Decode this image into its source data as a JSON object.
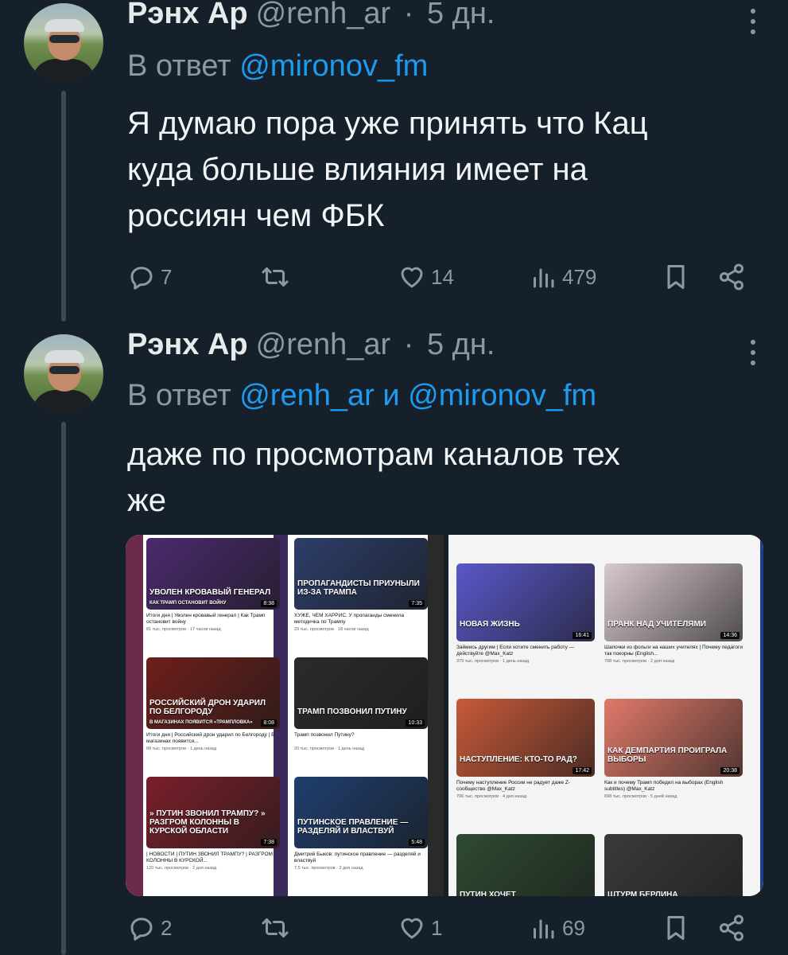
{
  "tweets": [
    {
      "author_name": "Рэнх Ар",
      "handle": "@renh_ar",
      "separator": "·",
      "time": "5 дн.",
      "reply_prefix": "В ответ",
      "reply_mentions": [
        "@mironov_fm"
      ],
      "reply_joiner": "",
      "text_lines": [
        "Я думаю пора уже принять что Кац",
        "куда больше влияния имеет на",
        "россиян чем ФБК"
      ],
      "stats": {
        "replies": "7",
        "retweets": "",
        "likes": "14",
        "views": "479"
      }
    },
    {
      "author_name": "Рэнх Ар",
      "handle": "@renh_ar",
      "separator": "·",
      "time": "5 дн.",
      "reply_prefix": "В ответ",
      "reply_mentions": [
        "@renh_ar",
        "@mironov_fm"
      ],
      "reply_joiner": "и",
      "text_lines": [
        "даже по просмотрам каналов тех",
        "же"
      ],
      "stats": {
        "replies": "2",
        "retweets": "",
        "likes": "1",
        "views": "69"
      }
    }
  ],
  "icons": {
    "more": "more-vertical-icon",
    "reply": "reply-icon",
    "retweet": "retweet-icon",
    "like": "heart-icon",
    "views": "views-icon",
    "bookmark": "bookmark-icon",
    "share": "share-icon"
  },
  "media": {
    "left_videos": [
      {
        "caption": "Уволен кровавый генерал",
        "sub": "Как Трамп остановит войну",
        "title": "Итоги дня | Уволен кровавый генерал | Как Трамп остановит войну",
        "meta": "81 тыс. просмотров · 17 часов назад",
        "duration": "8:38",
        "color": "#4a2a6e"
      },
      {
        "caption": "Пропагандисты приуныли из-за Трампа",
        "sub": "",
        "title": "ХУЖЕ, ЧЕМ ХАРРИС. У пропаганды сменила методичка по Трампу",
        "meta": "29 тыс. просмотров · 18 часов назад",
        "duration": "7:35",
        "color": "#2c3e6a"
      },
      {
        "caption": "Российский дрон ударил по Белгороду",
        "sub": "В магазинах появится «Трампловка»",
        "title": "Итоги дня | Российский дрон ударил по Белгороду | В магазинах появится...",
        "meta": "68 тыс. просмотров · 1 день назад",
        "duration": "8:08",
        "color": "#6e1f1a"
      },
      {
        "caption": "Трамп позвонил Путину",
        "sub": "",
        "title": "Трамп позвонил Путину?",
        "meta": "20 тыс. просмотров · 1 день назад",
        "duration": "10:33",
        "color": "#2b2b2b"
      },
      {
        "caption": "» Путин звонил Трампу? » Разгром колонны в Курской области",
        "sub": "",
        "title": "| НОВОСТИ | ПУТИН ЗВОНИЛ ТРАМПУ? | РАЗГРОМ КОЛОННЫ В КУРСКОЙ...",
        "meta": "120 тыс. просмотров · 2 дня назад",
        "duration": "7:38",
        "color": "#7a1f2a"
      },
      {
        "caption": "Путинское правление — разделяй и властвуй",
        "sub": "",
        "title": "Дмитрий Быков: путинское правление — разделяй и властвуй",
        "meta": "7,5 тыс. просмотров · 2 дня назад",
        "duration": "5:48",
        "color": "#1f3e6e"
      }
    ],
    "right_videos": [
      {
        "caption": "Новая жизнь",
        "title": "Займись другим | Если хотите сменить работу — действуйте @Max_Katz",
        "meta": "379 тыс. просмотров · 1 день назад",
        "duration": "16:41",
        "color": "#5a58c8"
      },
      {
        "caption": "Пранк над учителями",
        "title": "Шапочки из фольги на наших учителях | Почему педагоги так покорны (English...",
        "meta": "798 тыс. просмотров · 2 дня назад",
        "duration": "14:36",
        "color": "#d8c8d0"
      },
      {
        "caption": "Наступление: кто-то рад?",
        "title": "Почему наступление России не радует даже Z-сообщество @Max_Katz",
        "meta": "796 тыс. просмотров · 4 дня назад",
        "duration": "17:42",
        "color": "#c85a3a"
      },
      {
        "caption": "Как демпартия проиграла выборы",
        "title": "Как и почему Трамп победил на выборах (English subtitles) @Max_Katz",
        "meta": "698 тыс. просмотров · 5 дней назад",
        "duration": "20:38",
        "color": "#e07a6a"
      },
      {
        "caption": "Путин хочет",
        "title": "",
        "meta": "",
        "duration": "",
        "color": "#2e4a32"
      },
      {
        "caption": "Штурм Берлина",
        "title": "",
        "meta": "",
        "duration": "",
        "color": "#3a3a3a"
      }
    ]
  }
}
